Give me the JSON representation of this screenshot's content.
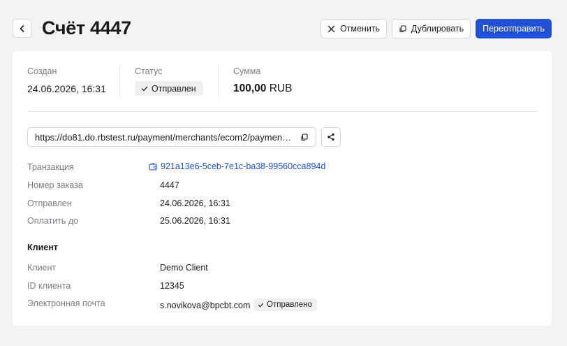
{
  "header": {
    "title": "Счёт 4447",
    "cancel_label": "Отменить",
    "duplicate_label": "Дублировать",
    "resend_label": "Переотправить"
  },
  "summary": {
    "created_label": "Создан",
    "created_value": "24.06.2026, 16:31",
    "status_label": "Статус",
    "status_value": "Отправлен",
    "amount_label": "Сумма",
    "amount_number": "100,00",
    "amount_currency": "RUB"
  },
  "payment_link": {
    "url": "https://do81.do.rbstest.ru/payment/merchants/ecom2/payment_r..."
  },
  "details": {
    "transaction_label": "Транзакция",
    "transaction_value": "921a13e6-5ceb-7e1c-ba38-99560cca894d",
    "order_label": "Номер заказа",
    "order_value": "4447",
    "sent_label": "Отправлен",
    "sent_value": "24.06.2026, 16:31",
    "pay_until_label": "Оплатить до",
    "pay_until_value": "25.06.2026, 16:31"
  },
  "client": {
    "section_title": "Клиент",
    "name_label": "Клиент",
    "name_value": "Demo Client",
    "id_label": "ID клиента",
    "id_value": "12345",
    "email_label": "Электронная почта",
    "email_value": "s.novikova@bpcbt.com",
    "email_status": "Отправлено"
  },
  "colors": {
    "primary": "#1f50d6",
    "background": "#f3f3f5",
    "muted_text": "#7c7c84"
  },
  "icons": [
    "chevron-left-icon",
    "close-icon",
    "copy-icon",
    "check-icon",
    "share-icon",
    "wallet-icon"
  ]
}
